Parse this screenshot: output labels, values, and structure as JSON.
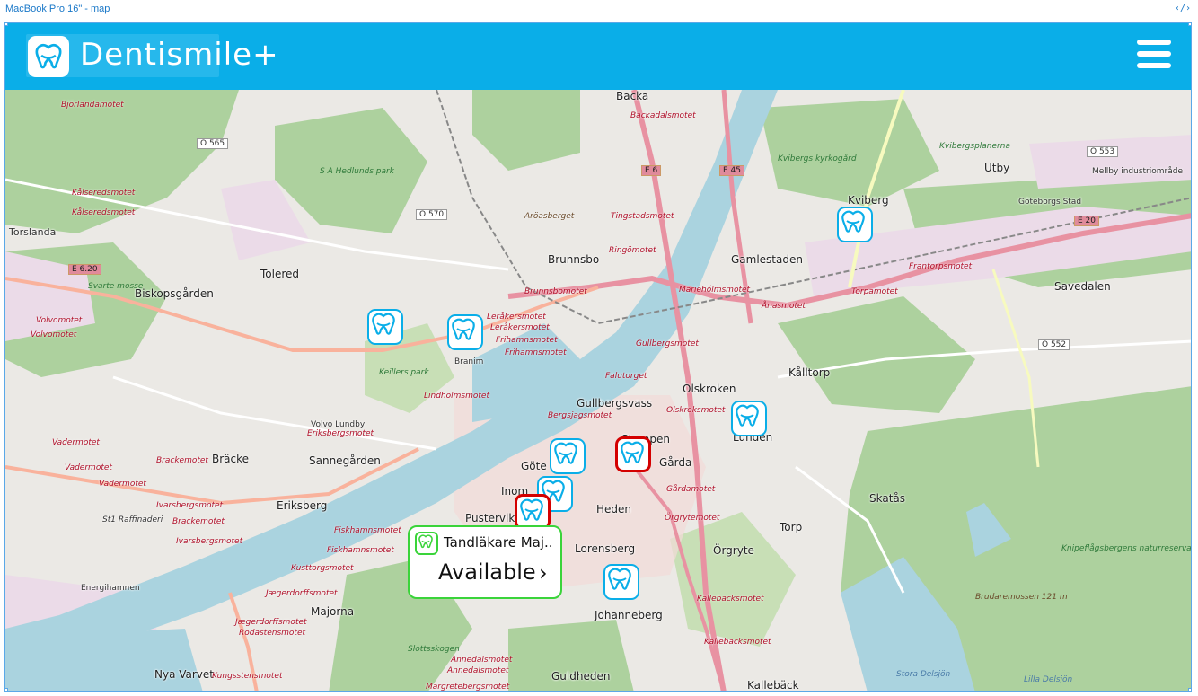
{
  "frame": {
    "label": "MacBook Pro 16\" - map",
    "code_icon": "code-icon"
  },
  "header": {
    "logo_text": "Dentismile+",
    "logo_icon": "tooth-icon",
    "menu_icon": "hamburger-menu-icon",
    "color": "#0aaee8"
  },
  "popup": {
    "title": "Tandläkare Maj..",
    "status": "Available",
    "chevron": "›",
    "border_color": "#3ad43a"
  },
  "colors": {
    "marker_border": "#0aaee8",
    "selected_border": "#d40000",
    "water": "#aad3df",
    "park": "#add19e",
    "motorway": "#e892a2"
  },
  "places": {
    "backa": "Backa",
    "brunnsbo": "Brunnsbo",
    "gamlestaden": "Gamlestaden",
    "kviberg": "Kviberg",
    "utby": "Utby",
    "savedalen": "Savedalen",
    "tolered": "Tolered",
    "biskopsgarden": "Biskopsgården",
    "kalltorp": "Kålltorp",
    "olskroken": "Olskroken",
    "gullbergsvass": "Gullbergsvass",
    "stampen": "Stampen",
    "garda": "Gårda",
    "lunden": "Lunden",
    "brack": "Bräcke",
    "sannegarden": "Sannegården",
    "eriksberg": "Eriksberg",
    "pustervik": "Pustervik",
    "inom": "Inom",
    "gote": "Göte",
    "heden": "Heden",
    "lorensberg": "Lorensberg",
    "orgryte": "Örgryte",
    "torp": "Torp",
    "skatas": "Skatås",
    "johanneberg": "Johanneberg",
    "majorna": "Majorna",
    "nya_varvet": "Nya Varvet",
    "guldheden": "Guldheden",
    "kalleback": "Kallebäck",
    "torslanda": "Torslanda",
    "svarte_mosse": "Svarte mosse",
    "sa_hedlunds": "S A Hedlunds park",
    "keillers": "Keillers park",
    "kviberg_kyrkogard": "Kvibergs kyrkogård",
    "mellby": "Mellby industriområde",
    "knipe": "Knipeflågsbergens naturreservat",
    "brudare": "Brudaremossen 121 m",
    "stora_delsjon": "Stora Delsjön",
    "lilla_delsjon": "Lilla Delsjön",
    "slottsskogen": "Slottsskogen",
    "energihamnen": "Energihamnen",
    "st1": "St1 Raffinaderi",
    "branim": "Branim",
    "volvo": "Volvo Lundby"
  },
  "roads": {
    "r1": "Björlandamotet",
    "r2": "Kålseredsmotet",
    "r3": "Kålseredsmotet",
    "r4": "Volvomotet",
    "r5": "Volvomotet",
    "r6": "Backadalsmotet",
    "r7": "Tingstadsmotet",
    "r8": "Ringömotet",
    "r9": "Brunnsbomotet",
    "r10": "Leråkersmotet",
    "r11": "Leråkersmotet",
    "r12": "Frihamnsmotet",
    "r13": "Frihamnsmotet",
    "r14": "Lindholmsmotet",
    "r15": "Eriksbergsmotet",
    "r16": "Brackemotet",
    "r17": "Vadermotet",
    "r18": "Vadermotet",
    "r19": "Vadermotet",
    "r20": "Ivarsbergsmotet",
    "r21": "Brackemotet",
    "r22": "Ivarsbergsmotet",
    "r23": "Fiskhamnsmotet",
    "r24": "Fiskhamnsmotet",
    "r25": "Kusttorgsmotet",
    "r26": "Jægerdorffsmotet",
    "r27": "Jægerdorffsmotet",
    "r28": "Rodastensmotet",
    "r29": "Kungsstensmotet",
    "r30": "Annedalsmotet",
    "r31": "Annedalsmotet",
    "r32": "Margretebergsmotet",
    "r33": "Kallebacksmotet",
    "r34": "Kallebacksmotet",
    "r35": "Gårdamotet",
    "r36": "Örgrytemotet",
    "r37": "Olskroksmotet",
    "r38": "Bergsjagsmotet",
    "r39": "Falutorget",
    "r40": "Gullbergsmotet",
    "r41": "Mariehólmsmotet",
    "r42": "Ånasmotet",
    "r43": "Torpamotet",
    "r44": "Frantorpsmotet",
    "r45": "Kvibergsplanerna",
    "r46": "Aröasberget",
    "r47": "Göteborgs Stad",
    "r48": "Slottsskogen"
  },
  "shields": {
    "e6": "E 6",
    "e45": "E 45",
    "e20": "E 20",
    "e620": "E 6.20",
    "o565": "O 565",
    "o570": "O 570",
    "o553": "O 553",
    "o552": "O 552"
  }
}
